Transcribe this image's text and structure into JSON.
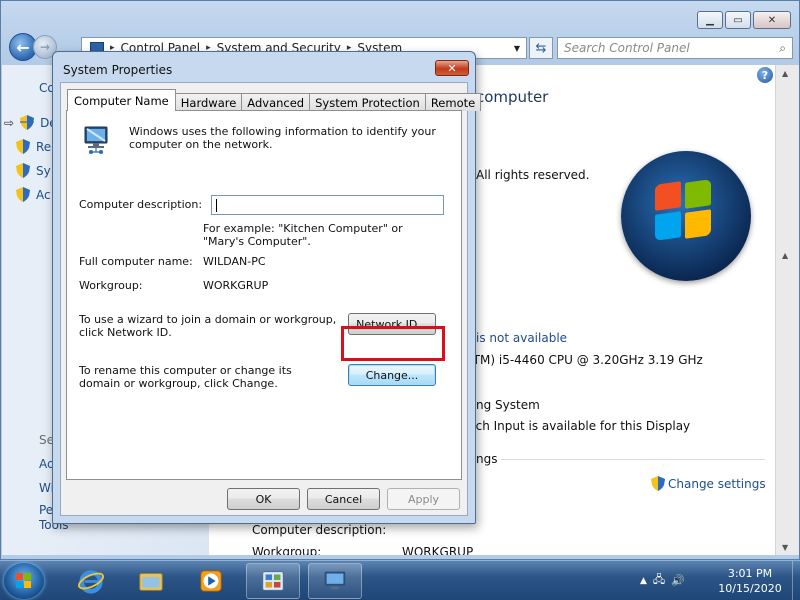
{
  "control_panel": {
    "breadcrumb": [
      "Control Panel",
      "System and Security",
      "System"
    ],
    "search_placeholder": "Search Control Panel",
    "left_top_label": "Co",
    "left_items": [
      "De",
      "Re",
      "Sy",
      "Ac"
    ],
    "left_see_also": "Se",
    "left_bottom_items": [
      "Ac",
      "Wi",
      "Pe",
      "Tools"
    ],
    "heading_fragment": "computer",
    "rights_fragment": "All rights reserved.",
    "rating_link_fragment": "is not available",
    "processor_fragment": "(TM) i5-4460  CPU @ 3.20GHz   3.19 GHz",
    "system_type_fragment": "ng System",
    "pen_touch_fragment": "uch Input is available for this Display",
    "settings_heading_fragment": "ngs",
    "change_settings_link": "Change settings",
    "computer_description_label": "Computer description:",
    "workgroup_label_cut": "Workgroup:",
    "workgroup_value_cut": "WORKGRUP"
  },
  "dialog": {
    "title": "System Properties",
    "tabs": [
      "Computer Name",
      "Hardware",
      "Advanced",
      "System Protection",
      "Remote"
    ],
    "active_tab": "Computer Name",
    "intro": "Windows uses the following information to identify your computer on the network.",
    "description_label": "Computer description:",
    "description_value": "",
    "example_text": "For example: \"Kitchen Computer\" or \"Mary's Computer\".",
    "full_name_label": "Full computer name:",
    "full_name_value": "WILDAN-PC",
    "workgroup_label": "Workgroup:",
    "workgroup_value": "WORKGRUP",
    "network_id_text": "To use a wizard to join a domain or workgroup, click Network ID.",
    "network_id_button": "Network ID...",
    "rename_text": "To rename this computer or change its domain or workgroup, click Change.",
    "change_button": "Change...",
    "ok_button": "OK",
    "cancel_button": "Cancel",
    "apply_button": "Apply"
  },
  "taskbar": {
    "time": "3:01 PM",
    "date": "10/15/2020"
  },
  "colors": {
    "highlight": "#d9101b",
    "link": "#1d4d8a"
  }
}
